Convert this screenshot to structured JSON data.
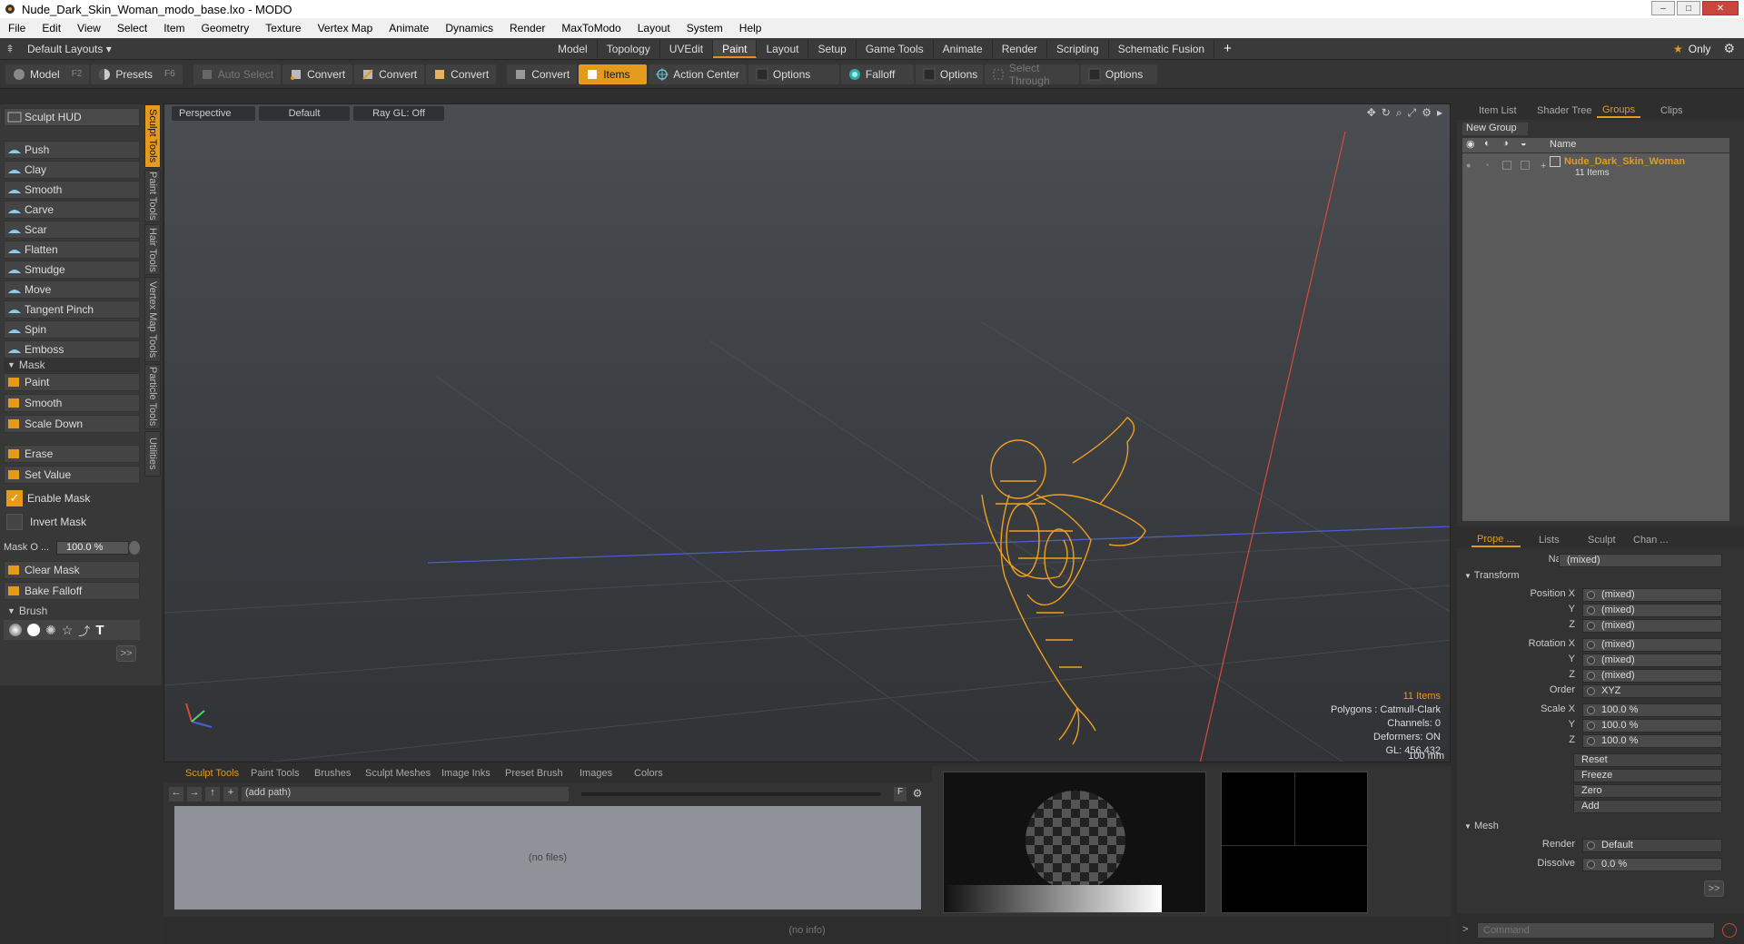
{
  "window": {
    "title": "Nude_Dark_Skin_Woman_modo_base.lxo - MODO"
  },
  "menu": [
    "File",
    "Edit",
    "View",
    "Select",
    "Item",
    "Geometry",
    "Texture",
    "Vertex Map",
    "Animate",
    "Dynamics",
    "Render",
    "MaxToModo",
    "Layout",
    "System",
    "Help"
  ],
  "layoutbar": {
    "layouts_label": "Default Layouts ▾",
    "tabs": [
      "Model",
      "Topology",
      "UVEdit",
      "Paint",
      "Layout",
      "Setup",
      "Game Tools",
      "Animate",
      "Render",
      "Scripting",
      "Schematic Fusion"
    ],
    "active_tab": "Paint",
    "add": "+",
    "only": "Only"
  },
  "toolbar": {
    "model": "Model",
    "model_key": "F2",
    "presets": "Presets",
    "presets_key": "F6",
    "auto_select": "Auto Select",
    "convert1": "Convert",
    "convert2": "Convert",
    "convert3": "Convert",
    "convert4": "Convert",
    "items": "Items",
    "action_center": "Action Center",
    "options1": "Options",
    "falloff": "Falloff",
    "options2": "Options",
    "select_through": "Select Through",
    "options3": "Options"
  },
  "left": {
    "sculpt_hud": "Sculpt HUD",
    "tools": [
      "Push",
      "Clay",
      "Smooth",
      "Carve",
      "Scar",
      "Flatten",
      "Smudge",
      "Move",
      "Tangent Pinch",
      "Spin",
      "Emboss"
    ],
    "mask_header": "Mask",
    "mask_tools": [
      "Paint",
      "Smooth",
      "Scale Down"
    ],
    "erase": "Erase",
    "set_value": "Set Value",
    "enable_mask": "Enable Mask",
    "invert_mask": "Invert Mask",
    "mask_opacity_label": "Mask O ...",
    "mask_opacity_value": "100.0 %",
    "clear_mask": "Clear Mask",
    "bake_falloff": "Bake Falloff",
    "brush_header": "Brush",
    "more": ">>",
    "vtabs": [
      "Sculpt Tools",
      "Paint Tools",
      "Hair Tools",
      "Vertex Map Tools",
      "Particle Tools",
      "Utilities"
    ]
  },
  "viewport": {
    "perspective": "Perspective",
    "default": "Default",
    "raygl": "Ray GL: Off",
    "stats": {
      "items": "11 Items",
      "polygons": "Polygons : Catmull-Clark",
      "channels": "Channels: 0",
      "deformers": "Deformers: ON",
      "gl": "GL: 456,432",
      "scale": "100 mm"
    }
  },
  "groups": {
    "tabs": [
      "Item List",
      "Shader Tree",
      "Groups",
      "Clips"
    ],
    "active_tab": "Groups",
    "new_group": "New Group",
    "col_name": "Name",
    "group_name": "Nude_Dark_Skin_Woman",
    "group_count": "11 Items"
  },
  "properties": {
    "tabs": [
      "Prope ...",
      "Lists",
      "Sculpt",
      "Chan ..."
    ],
    "active_tab": "Prope ...",
    "name_label": "Name",
    "name_value": "(mixed)",
    "transform_header": "Transform",
    "position_x": "Position X",
    "y": "Y",
    "z": "Z",
    "rotation_x": "Rotation X",
    "mixed": "(mixed)",
    "order_label": "Order",
    "order_value": "XYZ",
    "scale_x": "Scale X",
    "scale_value": "100.0 %",
    "reset": "Reset",
    "freeze": "Freeze",
    "zero": "Zero",
    "add": "Add",
    "mesh_header": "Mesh",
    "render_label": "Render",
    "render_value": "Default",
    "dissolve_label": "Dissolve",
    "dissolve_value": "0.0 %",
    "more": ">>"
  },
  "bottom": {
    "tabs": [
      "Sculpt Tools",
      "Paint Tools",
      "Brushes",
      "Sculpt Meshes",
      "Image Inks",
      "Preset Brush",
      "Images",
      "Colors"
    ],
    "active_tab": "Sculpt Tools",
    "path": "(add path)",
    "no_files": "(no files)",
    "f": "F"
  },
  "status": {
    "info": "(no info)",
    "command_placeholder": "Command"
  },
  "colors": {
    "accent": "#e69a1c",
    "wire": "#f0a020"
  }
}
